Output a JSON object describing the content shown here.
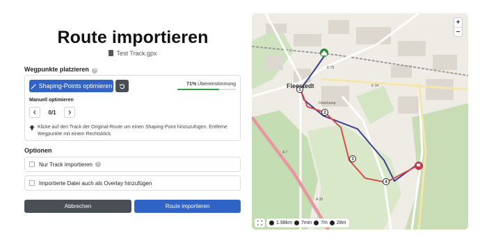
{
  "header": {
    "title": "Route importieren",
    "filename": "Test Track.gpx"
  },
  "waypoints": {
    "section_label": "Wegpunkte platzieren",
    "shaping_button": "Shaping-Points optimieren",
    "match_percent": "71%",
    "match_text": "Übereinstimmung",
    "match_fraction": 0.71,
    "manual_label": "Manuell optimieren",
    "pager_value": "0/1",
    "hint": "Klicke auf den Track der Original-Route um einen Shaping-Point hinzuzufügen. Entferne Wegpunkte mit einem Rechtsklick."
  },
  "options": {
    "section_label": "Optionen",
    "track_only": "Nur Track importieren",
    "overlay": "Importierte Datei auch als Overlay hinzufügen"
  },
  "actions": {
    "cancel": "Abbrechen",
    "import": "Route importieren"
  },
  "map": {
    "zoom_in": "+",
    "zoom_out": "−",
    "town_label": "Fleestedt",
    "road_labels": [
      "K 79",
      "K 34",
      "A 7",
      "A 39",
      "Osterkamp"
    ],
    "waypoint_numbers": [
      "1",
      "2",
      "3",
      "4"
    ],
    "stats": {
      "distance": "1.98km",
      "time": "7min",
      "ascent": "7m",
      "descent": "28m"
    },
    "colors": {
      "route_blue": "#3a3f8f",
      "track_red": "#d94a4a",
      "start_green": "#2e8b3e",
      "end_red": "#c0374a"
    }
  }
}
